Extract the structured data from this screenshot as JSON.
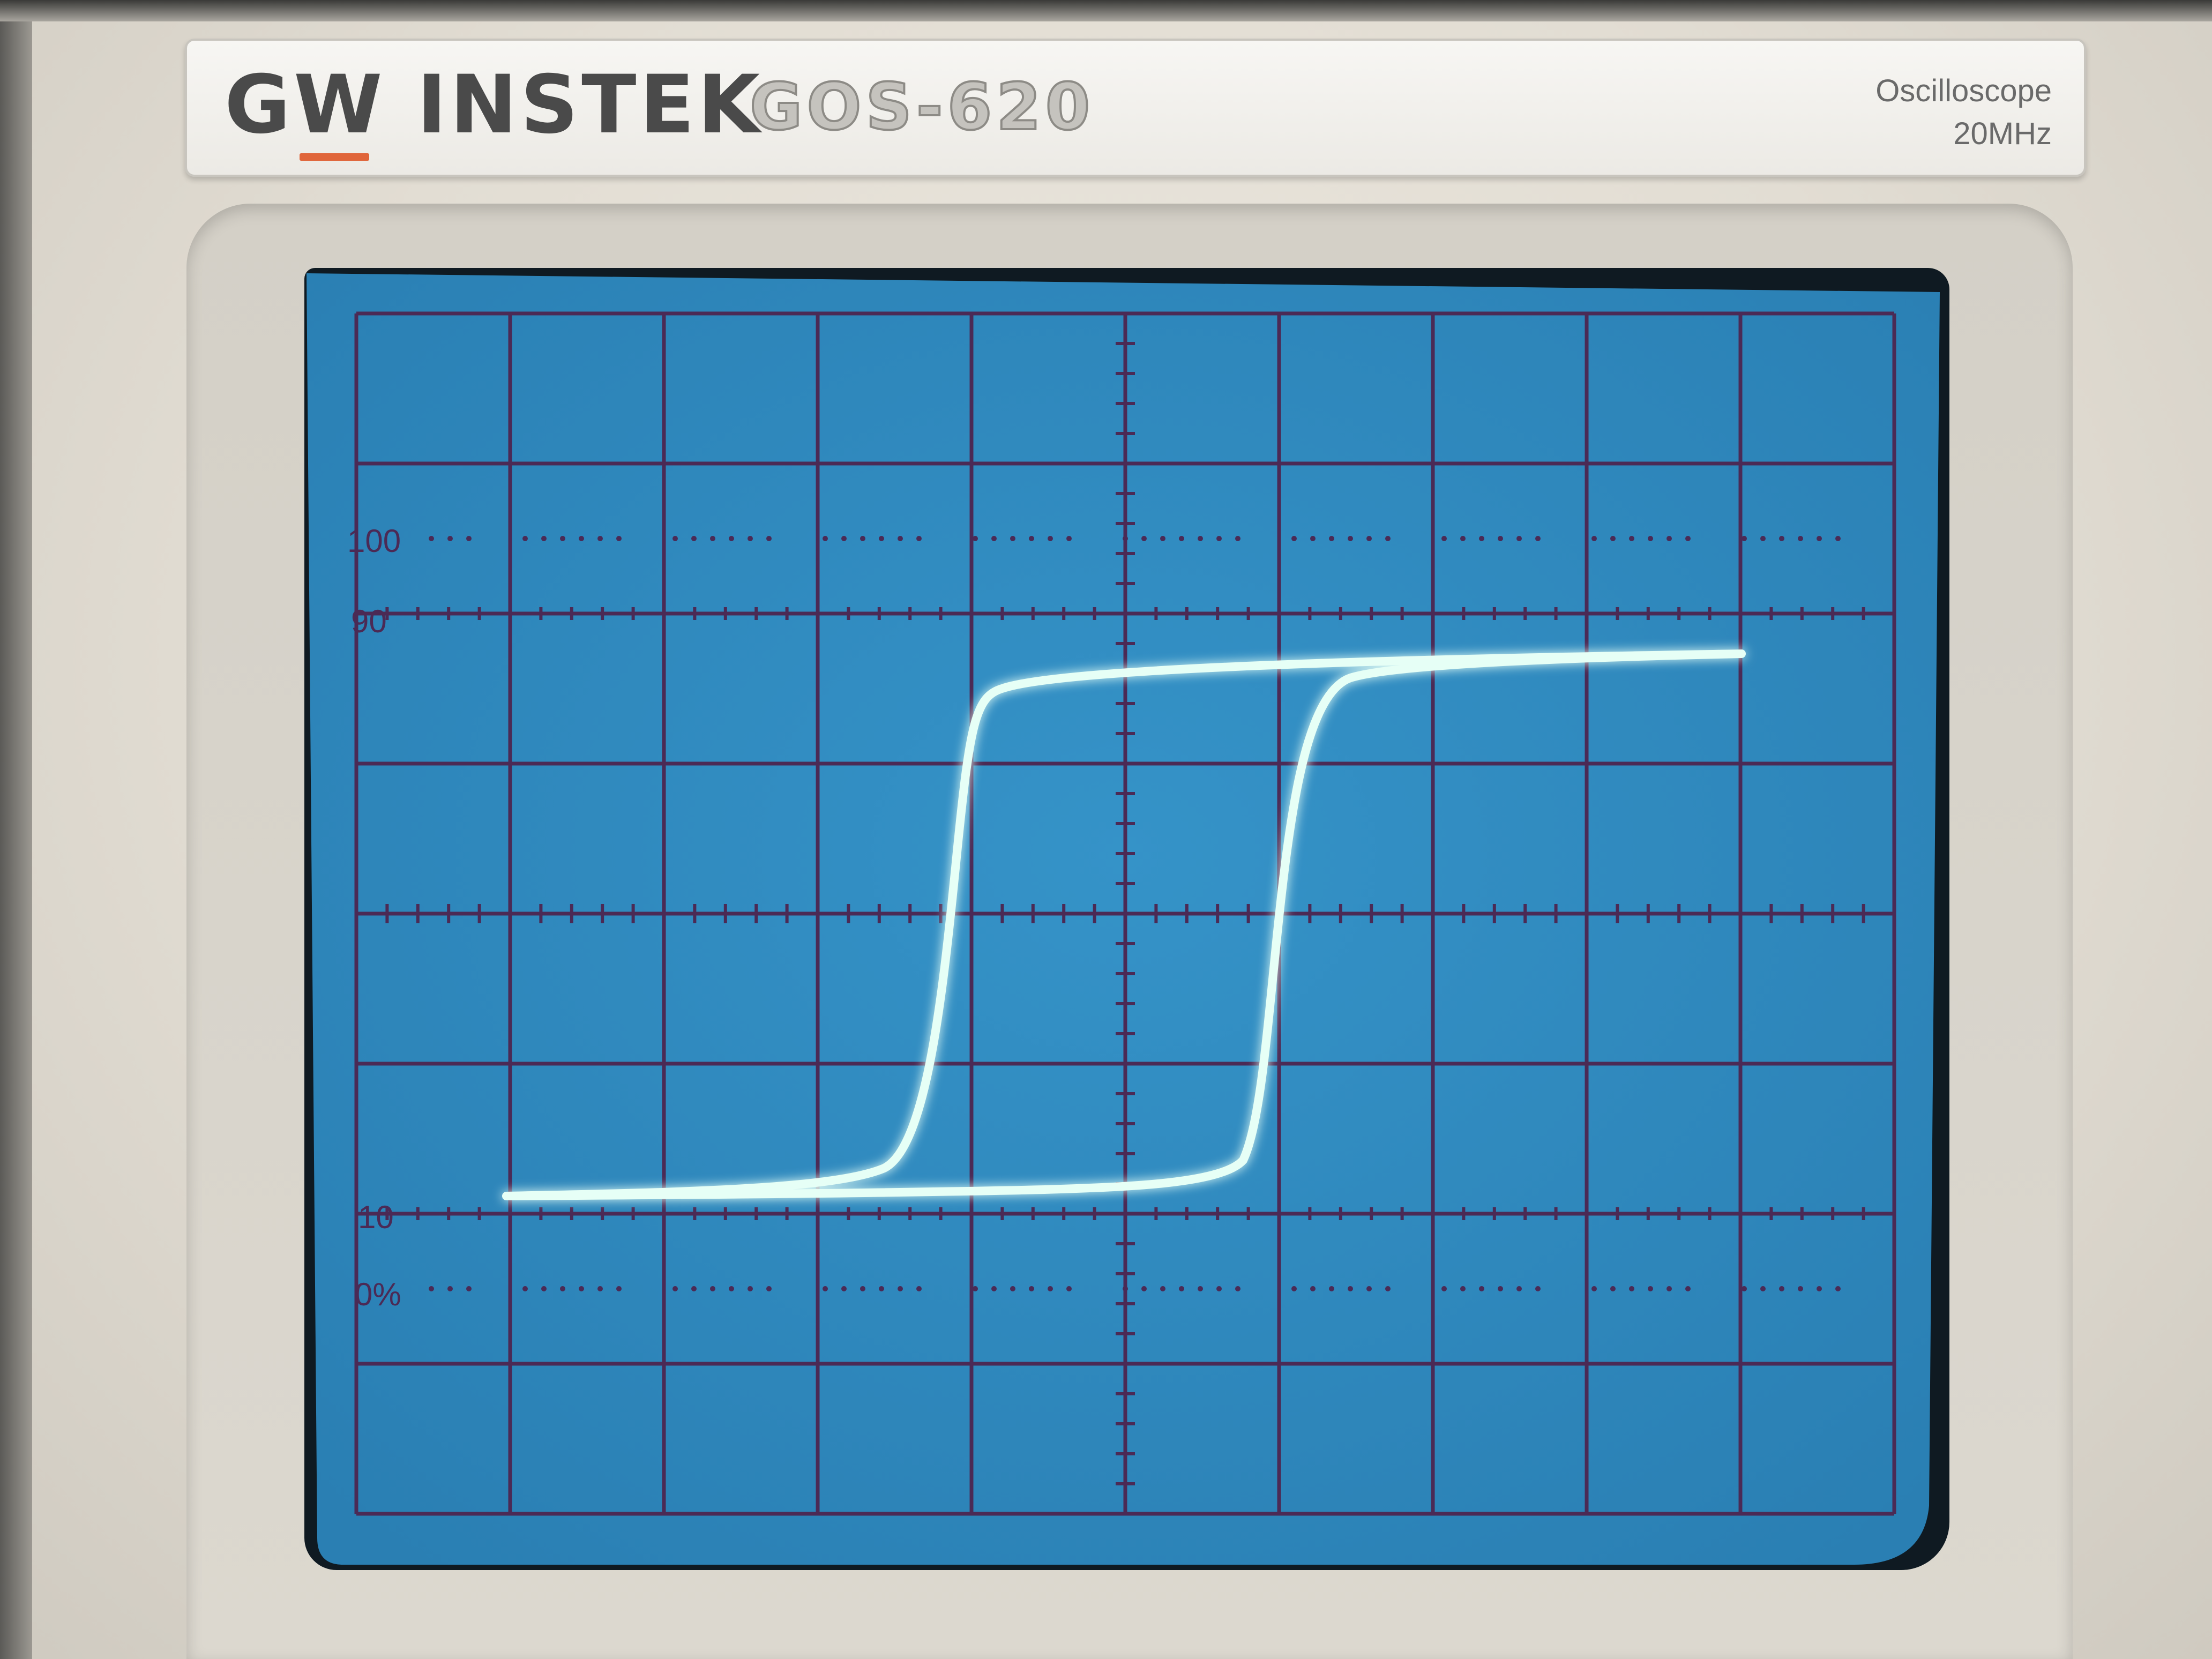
{
  "device": {
    "brand": "GW INSTEK",
    "model": "GOS-620",
    "type": "Oscilloscope",
    "bandwidth": "20MHz"
  },
  "screen": {
    "graticule_labels": [
      "100",
      "90",
      "10",
      "0%"
    ],
    "phosphor_color": "#e6fff6",
    "screen_color": "#2f89be",
    "grid_color": "#4b2a55"
  },
  "trace": {
    "description_shape": "hysteresis-loop"
  }
}
